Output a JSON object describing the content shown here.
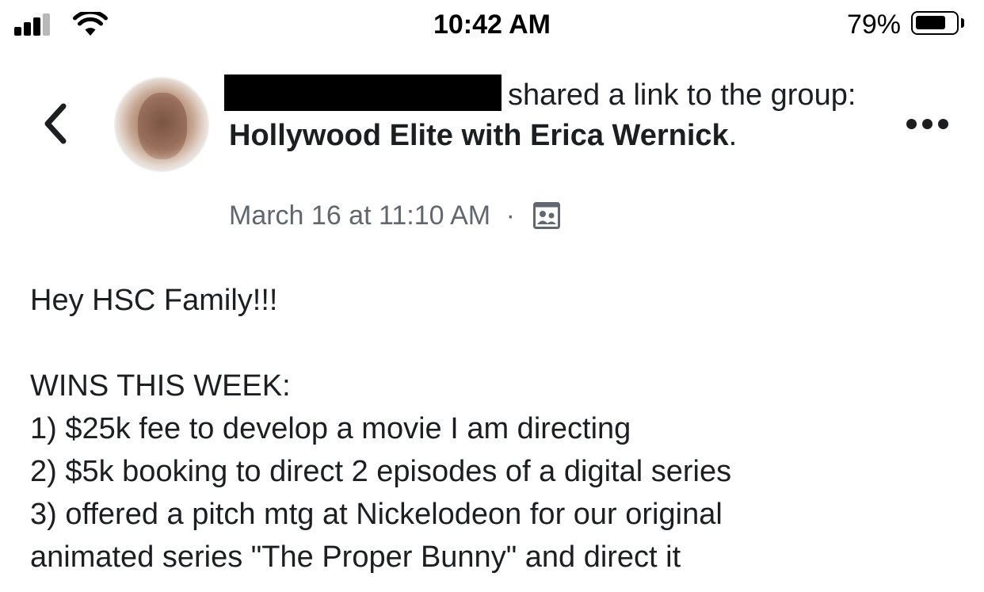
{
  "status_bar": {
    "time": "10:42 AM",
    "battery_percent": "79%",
    "battery_level": 0.79,
    "signal_bars_filled": 3,
    "signal_bars_total": 4
  },
  "post": {
    "author_name": "",
    "headline_action": "shared a link to the group:",
    "group_name": "Hollywood Elite with Erica Wernick",
    "headline_end": ".",
    "timestamp": "March 16 at 11:10 AM",
    "separator": "·",
    "audience_icon": "group-members-icon",
    "body": {
      "greeting": "Hey HSC Family!!!",
      "section_title": "WINS THIS WEEK:",
      "wins": [
        "1)  $25k fee to develop a movie I am directing",
        "2)  $5k booking to direct 2 episodes of a digital series",
        "3)  offered a pitch mtg at Nickelodeon for our original",
        "animated series \"The Proper Bunny\" and direct it"
      ]
    }
  },
  "icons": {
    "back": "chevron-left-icon",
    "more": "more-options-icon",
    "signal": "cellular-signal-icon",
    "wifi": "wifi-icon",
    "battery": "battery-icon"
  },
  "colors": {
    "text_primary": "#1c1e21",
    "text_secondary": "#606770",
    "background": "#ffffff"
  }
}
